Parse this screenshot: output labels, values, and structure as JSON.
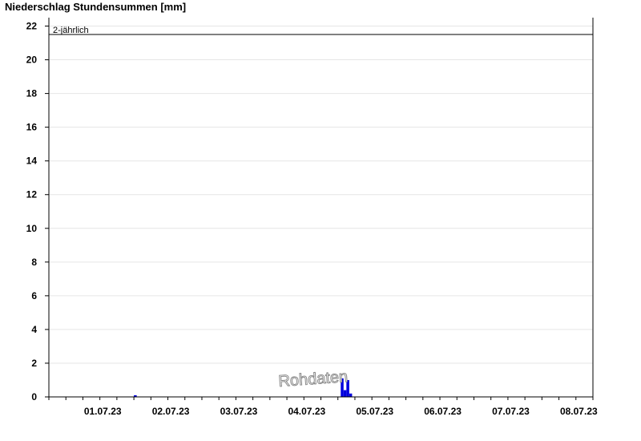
{
  "chart_data": {
    "type": "bar",
    "title": "Niederschlag Stundensummen [mm]",
    "xlabel": "",
    "ylabel": "",
    "ylim": [
      0,
      22.5
    ],
    "y_ticks": [
      0,
      2,
      4,
      6,
      8,
      10,
      12,
      14,
      16,
      18,
      20,
      22
    ],
    "y_tick_labels": [
      "0",
      "2",
      "4",
      "6",
      "8",
      "10",
      "12",
      "14",
      "16",
      "18",
      "20",
      "22"
    ],
    "x_range": [
      "2023-06-30T17:00",
      "2023-07-08T17:00"
    ],
    "x_tick_labels": [
      "01.07.23",
      "02.07.23",
      "03.07.23",
      "04.07.23",
      "05.07.23",
      "06.07.23",
      "07.07.23",
      "08.07.23"
    ],
    "grid": true,
    "series": [
      {
        "color": "#0000dd",
        "points": [
          {
            "t": "2023-07-01T23:00",
            "value": 0.1
          },
          {
            "t": "2023-07-05T00:00",
            "value": 1.1
          },
          {
            "t": "2023-07-05T01:00",
            "value": 0.4
          },
          {
            "t": "2023-07-05T02:00",
            "value": 1.0
          },
          {
            "t": "2023-07-05T03:00",
            "value": 0.2
          }
        ]
      }
    ],
    "reference_lines": [
      {
        "label": "2-jährlich",
        "value": 21.5,
        "color": "#000000"
      }
    ],
    "watermark": "Rohdaten"
  }
}
